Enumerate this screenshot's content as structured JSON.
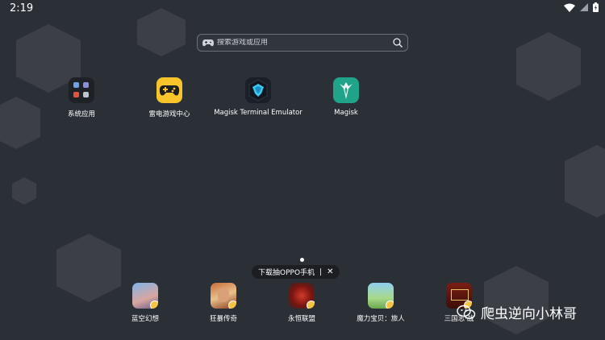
{
  "status_bar": {
    "time": "2:19",
    "icons": [
      "wifi-icon",
      "signal-icon",
      "battery-icon"
    ]
  },
  "search": {
    "placeholder": "搜索游戏或应用"
  },
  "apps": [
    {
      "label": "系统应用",
      "icon": "system-apps-folder-icon"
    },
    {
      "label": "雷电游戏中心",
      "icon": "game-controller-icon"
    },
    {
      "label": "Magisk Terminal Emulator",
      "icon": "magisk-terminal-icon"
    },
    {
      "label": "Magisk",
      "icon": "magisk-icon"
    }
  ],
  "promo_banner": {
    "text": "下载抽OPPO手机",
    "divider": "|",
    "close": "✕"
  },
  "dock": [
    {
      "label": "蓝空幻想",
      "icon": "game-icon"
    },
    {
      "label": "狂暴传奇",
      "icon": "game-icon"
    },
    {
      "label": "永恒联盟",
      "icon": "game-icon"
    },
    {
      "label": "魔力宝贝：旅人",
      "icon": "game-icon"
    },
    {
      "label": "三国志·战",
      "icon": "game-icon"
    }
  ],
  "watermark": {
    "text": "爬虫逆向小林哥"
  },
  "colors": {
    "background": "#2b2f36",
    "game_center_yellow": "#f7c52b",
    "magisk_teal": "#1fa389"
  }
}
